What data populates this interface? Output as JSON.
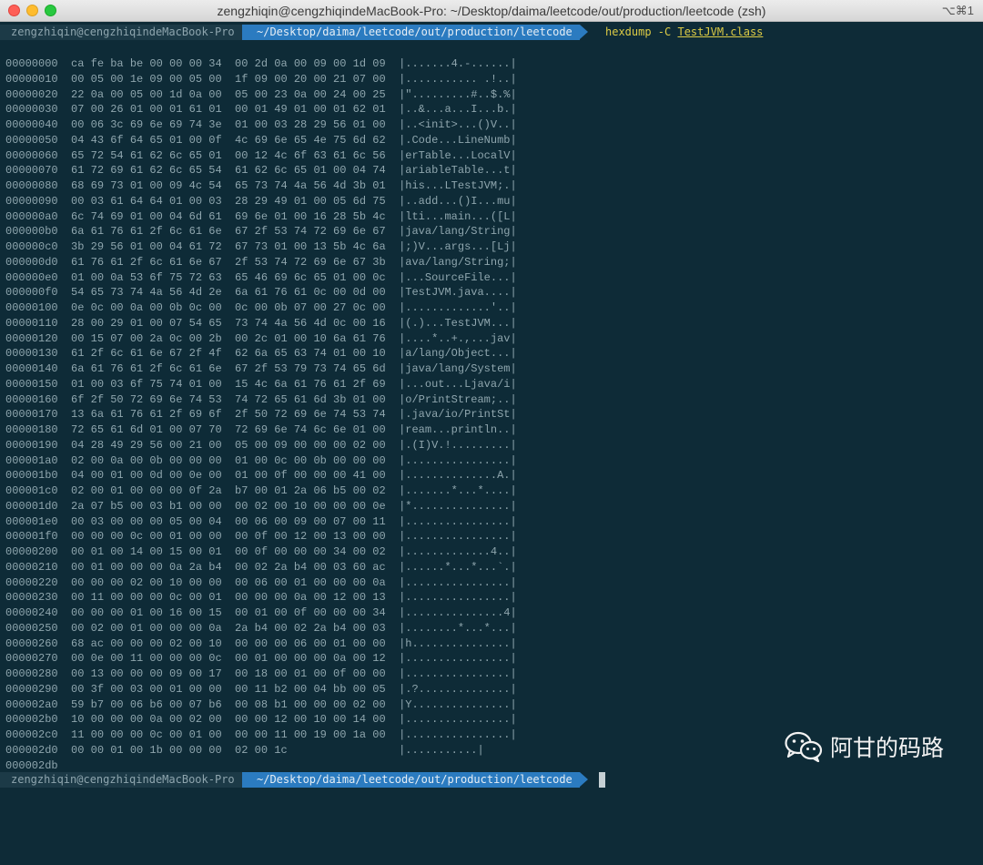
{
  "window": {
    "title": "zengzhiqin@cengzhiqindeMacBook-Pro: ~/Desktop/daima/leetcode/out/production/leetcode (zsh)",
    "shortcut": "⌥⌘1"
  },
  "prompt": {
    "user_host": "zengzhiqin@cengzhiqindeMacBook-Pro",
    "path": "~/Desktop/daima/leetcode/out/production/leetcode",
    "command": "hexdump -C",
    "argument": "TestJVM.class"
  },
  "hexdump_lines": [
    "00000000  ca fe ba be 00 00 00 34  00 2d 0a 00 09 00 1d 09  |.......4.-......|",
    "00000010  00 05 00 1e 09 00 05 00  1f 09 00 20 00 21 07 00  |........... .!..|",
    "00000020  22 0a 00 05 00 1d 0a 00  05 00 23 0a 00 24 00 25  |\".........#..$.%|",
    "00000030  07 00 26 01 00 01 61 01  00 01 49 01 00 01 62 01  |..&...a...I...b.|",
    "00000040  00 06 3c 69 6e 69 74 3e  01 00 03 28 29 56 01 00  |..<init>...()V..|",
    "00000050  04 43 6f 64 65 01 00 0f  4c 69 6e 65 4e 75 6d 62  |.Code...LineNumb|",
    "00000060  65 72 54 61 62 6c 65 01  00 12 4c 6f 63 61 6c 56  |erTable...LocalV|",
    "00000070  61 72 69 61 62 6c 65 54  61 62 6c 65 01 00 04 74  |ariableTable...t|",
    "00000080  68 69 73 01 00 09 4c 54  65 73 74 4a 56 4d 3b 01  |his...LTestJVM;.|",
    "00000090  00 03 61 64 64 01 00 03  28 29 49 01 00 05 6d 75  |..add...()I...mu|",
    "000000a0  6c 74 69 01 00 04 6d 61  69 6e 01 00 16 28 5b 4c  |lti...main...([L|",
    "000000b0  6a 61 76 61 2f 6c 61 6e  67 2f 53 74 72 69 6e 67  |java/lang/String|",
    "000000c0  3b 29 56 01 00 04 61 72  67 73 01 00 13 5b 4c 6a  |;)V...args...[Lj|",
    "000000d0  61 76 61 2f 6c 61 6e 67  2f 53 74 72 69 6e 67 3b  |ava/lang/String;|",
    "000000e0  01 00 0a 53 6f 75 72 63  65 46 69 6c 65 01 00 0c  |...SourceFile...|",
    "000000f0  54 65 73 74 4a 56 4d 2e  6a 61 76 61 0c 00 0d 00  |TestJVM.java....|",
    "00000100  0e 0c 00 0a 00 0b 0c 00  0c 00 0b 07 00 27 0c 00  |.............'..|",
    "00000110  28 00 29 01 00 07 54 65  73 74 4a 56 4d 0c 00 16  |(.)...TestJVM...|",
    "00000120  00 15 07 00 2a 0c 00 2b  00 2c 01 00 10 6a 61 76  |....*..+.,...jav|",
    "00000130  61 2f 6c 61 6e 67 2f 4f  62 6a 65 63 74 01 00 10  |a/lang/Object...|",
    "00000140  6a 61 76 61 2f 6c 61 6e  67 2f 53 79 73 74 65 6d  |java/lang/System|",
    "00000150  01 00 03 6f 75 74 01 00  15 4c 6a 61 76 61 2f 69  |...out...Ljava/i|",
    "00000160  6f 2f 50 72 69 6e 74 53  74 72 65 61 6d 3b 01 00  |o/PrintStream;..|",
    "00000170  13 6a 61 76 61 2f 69 6f  2f 50 72 69 6e 74 53 74  |.java/io/PrintSt|",
    "00000180  72 65 61 6d 01 00 07 70  72 69 6e 74 6c 6e 01 00  |ream...println..|",
    "00000190  04 28 49 29 56 00 21 00  05 00 09 00 00 00 02 00  |.(I)V.!.........|",
    "000001a0  02 00 0a 00 0b 00 00 00  01 00 0c 00 0b 00 00 00  |................|",
    "000001b0  04 00 01 00 0d 00 0e 00  01 00 0f 00 00 00 41 00  |..............A.|",
    "000001c0  02 00 01 00 00 00 0f 2a  b7 00 01 2a 06 b5 00 02  |.......*...*....|",
    "000001d0  2a 07 b5 00 03 b1 00 00  00 02 00 10 00 00 00 0e  |*...............|",
    "000001e0  00 03 00 00 00 05 00 04  00 06 00 09 00 07 00 11  |................|",
    "000001f0  00 00 00 0c 00 01 00 00  00 0f 00 12 00 13 00 00  |................|",
    "00000200  00 01 00 14 00 15 00 01  00 0f 00 00 00 34 00 02  |.............4..|",
    "00000210  00 01 00 00 00 0a 2a b4  00 02 2a b4 00 03 60 ac  |......*...*...`.|",
    "00000220  00 00 00 02 00 10 00 00  00 06 00 01 00 00 00 0a  |................|",
    "00000230  00 11 00 00 00 0c 00 01  00 00 00 0a 00 12 00 13  |................|",
    "00000240  00 00 00 01 00 16 00 15  00 01 00 0f 00 00 00 34  |...............4|",
    "00000250  00 02 00 01 00 00 00 0a  2a b4 00 02 2a b4 00 03  |........*...*...|",
    "00000260  68 ac 00 00 00 02 00 10  00 00 00 06 00 01 00 00  |h...............|",
    "00000270  00 0e 00 11 00 00 00 0c  00 01 00 00 00 0a 00 12  |................|",
    "00000280  00 13 00 00 00 09 00 17  00 18 00 01 00 0f 00 00  |................|",
    "00000290  00 3f 00 03 00 01 00 00  00 11 b2 00 04 bb 00 05  |.?..............|",
    "000002a0  59 b7 00 06 b6 00 07 b6  00 08 b1 00 00 00 02 00  |Y...............|",
    "000002b0  10 00 00 00 0a 00 02 00  00 00 12 00 10 00 14 00  |................|",
    "000002c0  11 00 00 00 0c 00 01 00  00 00 11 00 19 00 1a 00  |................|",
    "000002d0  00 00 01 00 1b 00 00 00  02 00 1c                 |...........|",
    "000002db"
  ],
  "watermark": {
    "text": "阿甘的码路",
    "icon": "wechat-icon"
  },
  "colors": {
    "terminal_bg": "#0e2b37",
    "text": "#8fa6ae",
    "path_segment": "#2b7bc0",
    "command": "#dccb45"
  }
}
